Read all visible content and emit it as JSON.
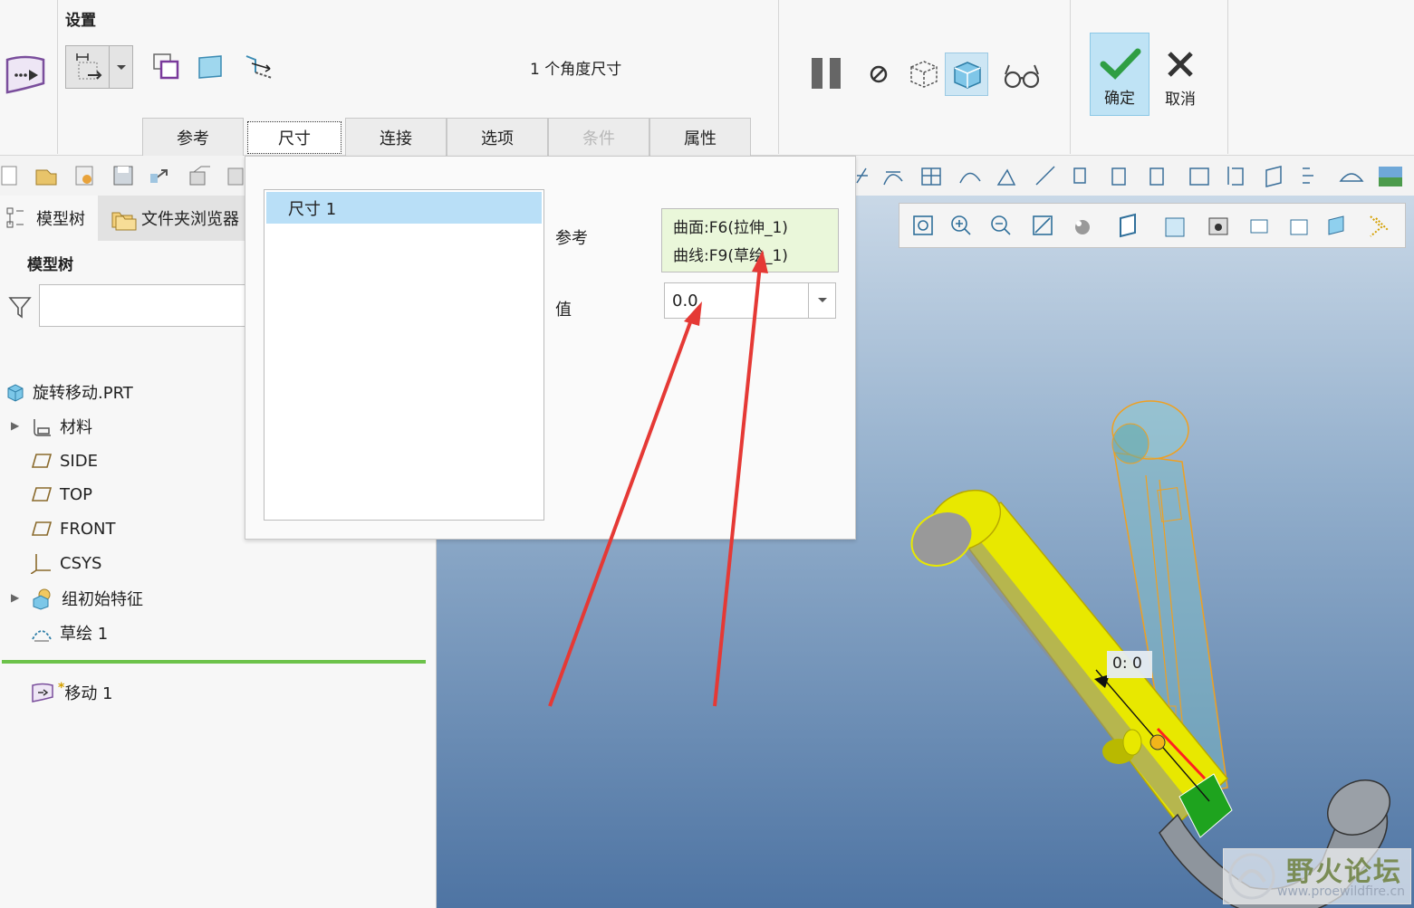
{
  "ribbon": {
    "settings_label": "设置",
    "angle_info": "1 个角度尺寸",
    "tabs": [
      {
        "label": "参考",
        "state": "normal"
      },
      {
        "label": "尺寸",
        "state": "active"
      },
      {
        "label": "连接",
        "state": "normal"
      },
      {
        "label": "选项",
        "state": "normal"
      },
      {
        "label": "条件",
        "state": "disabled"
      },
      {
        "label": "属性",
        "state": "normal"
      }
    ],
    "ok_label": "确定",
    "cancel_label": "取消"
  },
  "panel": {
    "tabs": [
      "模型树",
      "文件夹浏览器"
    ],
    "tree_title": "模型树",
    "search_value": "",
    "items": [
      {
        "label": "旋转移动.PRT",
        "icon": "part-icon"
      },
      {
        "label": "材料",
        "icon": "material-icon",
        "expandable": true
      },
      {
        "label": "SIDE",
        "icon": "datum-plane-icon"
      },
      {
        "label": "TOP",
        "icon": "datum-plane-icon"
      },
      {
        "label": "FRONT",
        "icon": "datum-plane-icon"
      },
      {
        "label": "CSYS",
        "icon": "csys-icon"
      },
      {
        "label": "组初始特征",
        "icon": "group-icon",
        "expandable": true
      },
      {
        "label": "草绘 1",
        "icon": "sketch-icon"
      },
      {
        "label": "移动 1",
        "icon": "move-feature-icon",
        "marker": "*"
      }
    ]
  },
  "popup": {
    "dimensions": [
      "尺寸 1"
    ],
    "ref_label": "参考",
    "references": [
      "曲面:F6(拉伸_1)",
      "曲线:F9(草绘_1)"
    ],
    "value_label": "值",
    "value": "0.0"
  },
  "viewport": {
    "dim_label": "0: 0"
  },
  "watermark": {
    "title": "野火论坛",
    "url": "www.proewildfire.cn"
  },
  "colors": {
    "ok_bg": "#bfe3f5",
    "selection": "#b9dff7",
    "ref_bg": "#eaf7da",
    "annotation_arrow": "#e53935",
    "part_yellow": "#e8e800"
  }
}
